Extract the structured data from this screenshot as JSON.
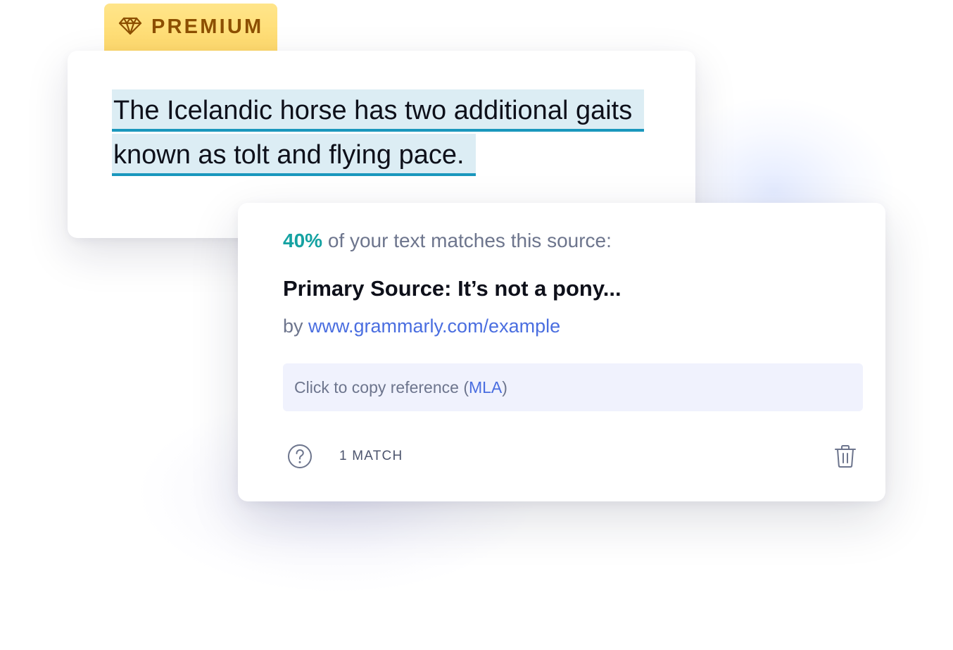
{
  "badge": {
    "label": "PREMIUM",
    "icon": "diamond-icon",
    "color": "#8c4f00",
    "background": "#ffe07a"
  },
  "document": {
    "highlighted_lines": [
      "The Icelandic horse has two additional gaits",
      "known as tolt and flying pace."
    ],
    "highlight_color": "#dcedf4",
    "underline_color": "#1a97bd"
  },
  "source_card": {
    "match_percent": "40%",
    "match_text": " of your text matches this source:",
    "source_title": "Primary Source: It’s not a pony...",
    "by_prefix": "by ",
    "source_url": "www.grammarly.com/example",
    "copy_reference": {
      "prefix": "Click to copy reference (",
      "style": "MLA",
      "suffix": ")"
    },
    "match_count": "1 MATCH",
    "help_icon": "question-circle-icon",
    "delete_icon": "trash-icon",
    "accent_color": "#15a2a2",
    "link_color": "#4a6ee0"
  }
}
